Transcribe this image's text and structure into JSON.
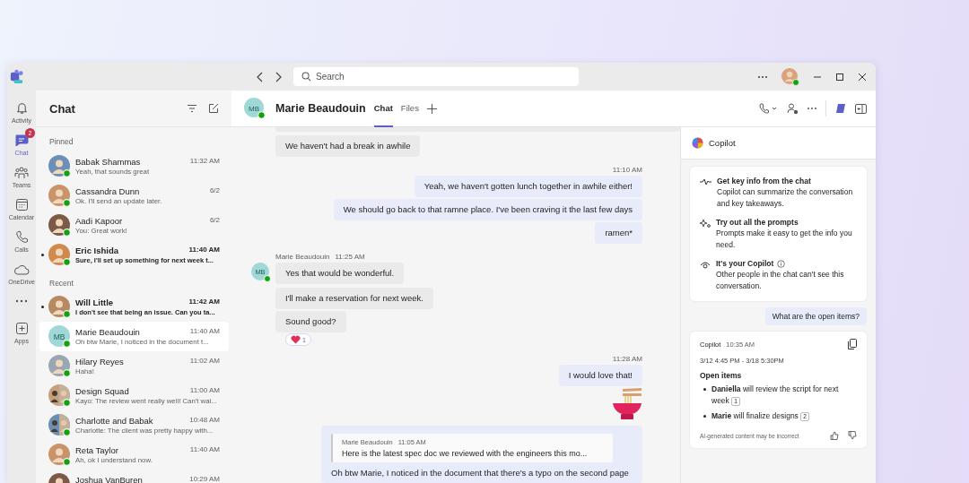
{
  "title_bar": {
    "search": {
      "placeholder": "Search"
    }
  },
  "rail": [
    {
      "label": "Activity",
      "selected": false
    },
    {
      "label": "Chat",
      "selected": true,
      "badge": "2"
    },
    {
      "label": "Teams",
      "selected": false
    },
    {
      "label": "Calendar",
      "selected": false
    },
    {
      "label": "Calls",
      "selected": false
    },
    {
      "label": "OneDrive",
      "selected": false
    },
    {
      "label": "Apps",
      "selected": false
    }
  ],
  "chat_list": {
    "title": "Chat",
    "sections": [
      {
        "title": "Pinned",
        "items": [
          {
            "name": "Babak Shammas",
            "time": "11:32 AM",
            "preview": "Yeah, that sounds great",
            "unread": false,
            "selected": false
          },
          {
            "name": "Cassandra Dunn",
            "time": "6/2",
            "preview": "Ok. I'll send an update later.",
            "unread": false,
            "selected": false
          },
          {
            "name": "Aadi Kapoor",
            "time": "6/2",
            "preview": "You: Great work!",
            "unread": false,
            "selected": false
          },
          {
            "name": "Eric Ishida",
            "time": "11:40 AM",
            "preview": "Sure, I'll set up something for next week t...",
            "unread": true,
            "selected": false
          }
        ]
      },
      {
        "title": "Recent",
        "items": [
          {
            "name": "Will Little",
            "time": "11:42 AM",
            "preview": "I don't see that being an issue. Can you ta...",
            "unread": true,
            "selected": false
          },
          {
            "initials": "MB",
            "name": "Marie Beaudouin",
            "time": "11:40 AM",
            "preview": "Oh btw Marie, I noticed in the document t...",
            "unread": false,
            "selected": true
          },
          {
            "name": "Hilary Reyes",
            "time": "11:02 AM",
            "preview": "Haha!",
            "unread": false,
            "selected": false
          },
          {
            "name": "Design Squad",
            "time": "11:00 AM",
            "preview": "Kayo: The review went really well! Can't wai...",
            "unread": false,
            "selected": false
          },
          {
            "name": "Charlotte and Babak",
            "time": "10:48 AM",
            "preview": "Charlotte: The client was pretty happy with...",
            "unread": false,
            "selected": false
          },
          {
            "name": "Reta Taylor",
            "time": "11:40 AM",
            "preview": "Ah, ok I understand now.",
            "unread": false,
            "selected": false
          },
          {
            "name": "Joshua VanBuren",
            "time": "10:29 AM",
            "unread": false,
            "selected": false
          }
        ]
      }
    ]
  },
  "conversation": {
    "header": {
      "initials": "MB",
      "name": "Marie Beaudouin",
      "tabs": [
        {
          "label": "Chat",
          "selected": true
        },
        {
          "label": "Files",
          "selected": false
        }
      ]
    },
    "messages": [
      {
        "kind": "in",
        "text": "We haven't had a break in awhile"
      },
      {
        "kind": "time",
        "text": "11:10 AM"
      },
      {
        "kind": "out",
        "text": "Yeah, we haven't gotten lunch together in awhile either!"
      },
      {
        "kind": "out",
        "text": "We should go back to that ramne place. I've been craving it the last few days"
      },
      {
        "kind": "out",
        "text": "ramen*"
      },
      {
        "kind": "sender",
        "name": "Marie Beaudouin",
        "time": "11:25 AM"
      },
      {
        "kind": "in",
        "initials": "MB",
        "text": "Yes that would be wonderful."
      },
      {
        "kind": "in",
        "text": "I'll make a reservation for next week."
      },
      {
        "kind": "in",
        "text": "Sound good?",
        "reaction": "1"
      },
      {
        "kind": "time",
        "text": "11:28 AM"
      },
      {
        "kind": "out",
        "text": "I would love that!"
      },
      {
        "kind": "sticker"
      },
      {
        "kind": "quote",
        "author": "Marie Beaudouin",
        "time": "11:05 AM",
        "quote": "Here is the latest spec doc we reviewed with the engineers this mo...",
        "text": "Oh btw Marie, I noticed in the document that there's a typo on the second page"
      }
    ]
  },
  "copilot": {
    "title": "Copilot",
    "tips": [
      {
        "title": "Get key info from the chat",
        "text": "Copilot can summarize the conversation and key takeaways.",
        "info": false
      },
      {
        "title": "Try out all the prompts",
        "text": "Prompts make it easy to get the info you need.",
        "info": false
      },
      {
        "title": "It's your Copilot",
        "text": "Other people in the chat can't see this conversation.",
        "info": true
      }
    ],
    "prompt": "What are the open items?",
    "response": {
      "author": "Copilot",
      "time": "10:35 AM",
      "range": "3/12 4:45 PM - 3/18 5:30PM",
      "heading": "Open items",
      "items": [
        {
          "text": "**Daniella** will review the script for next week",
          "ref": "1"
        },
        {
          "text": "**Marie** will finalize designs",
          "ref": "2"
        }
      ],
      "disclaimer": "AI-generated content may be incorrect"
    }
  }
}
